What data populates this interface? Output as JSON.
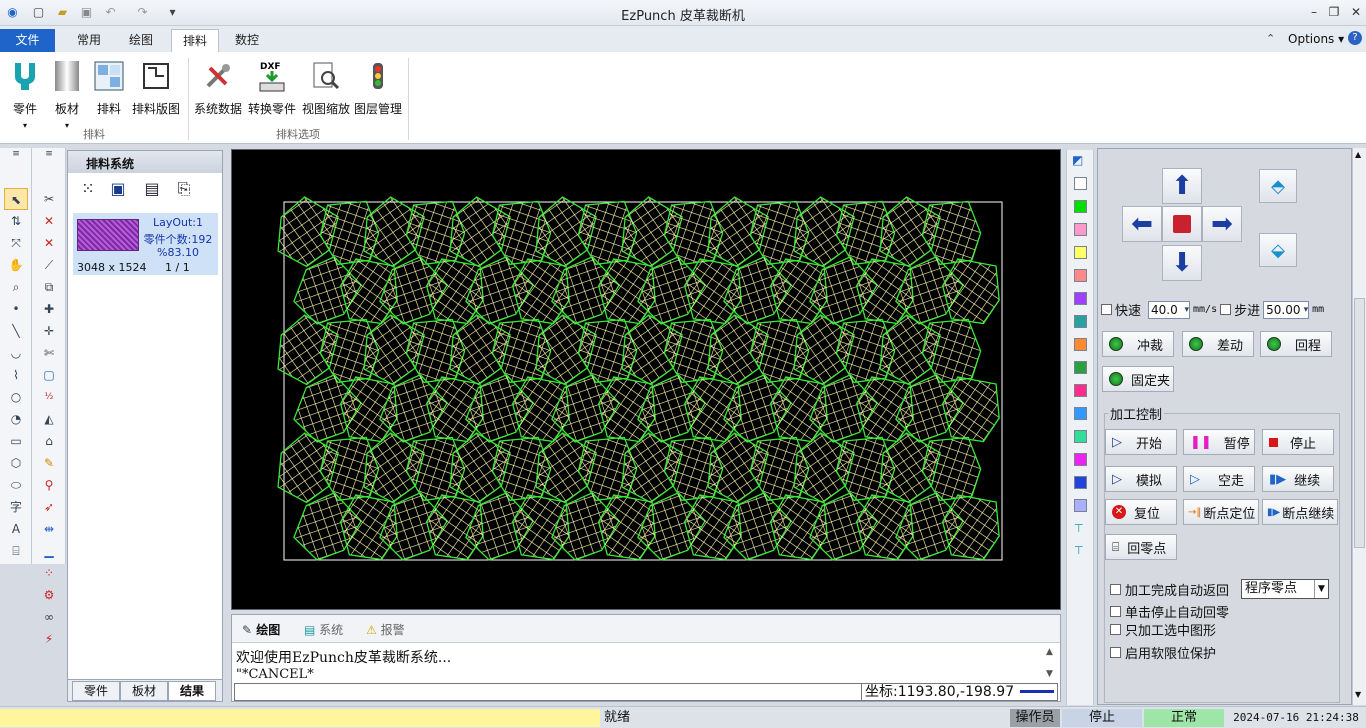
{
  "window": {
    "title": "EzPunch 皮革裁断机",
    "options_label": "Options"
  },
  "tabs": [
    {
      "label": "文件"
    },
    {
      "label": "常用"
    },
    {
      "label": "绘图"
    },
    {
      "label": "排料"
    },
    {
      "label": "数控"
    }
  ],
  "ribbon": {
    "group1": {
      "label": "排料",
      "buttons": [
        {
          "label": "零件",
          "icon": "part-icon"
        },
        {
          "label": "板材",
          "icon": "sheet-icon"
        },
        {
          "label": "排料",
          "icon": "nesting-icon"
        },
        {
          "label": "排料版图",
          "icon": "layout-icon"
        }
      ]
    },
    "group2": {
      "label": "排料选项",
      "buttons": [
        {
          "label": "系统数据",
          "icon": "settings-tools-icon"
        },
        {
          "label": "转换零件",
          "icon": "dxf-convert-icon"
        },
        {
          "label": "视图缩放",
          "icon": "zoom-view-icon"
        },
        {
          "label": "图层管理",
          "icon": "layer-traffic-icon"
        }
      ]
    }
  },
  "nest_panel": {
    "title": "排料系统",
    "layout": {
      "name": "LayOut:1",
      "count": "零件个数:192",
      "percent": "%83.10",
      "size": "3048 x 1524",
      "page": "1 / 1"
    },
    "tabs": [
      {
        "label": "零件"
      },
      {
        "label": "板材"
      },
      {
        "label": "结果"
      }
    ]
  },
  "command": {
    "tabs": [
      {
        "label": "绘图"
      },
      {
        "label": "系统"
      },
      {
        "label": "报警"
      }
    ],
    "line1": "欢迎使用EzPunch皮革裁断系统...",
    "line2": "\"*CANCEL*",
    "coord": "坐标:1193.80,-198.97"
  },
  "control": {
    "fast_label": "快速",
    "fast_value": "40.0",
    "speed_unit": "mm/s",
    "step_label": "步进",
    "step_value": "50.00",
    "step_unit": "mm",
    "punch": "冲裁",
    "jog": "差动",
    "return": "回程",
    "clamp": "固定夹",
    "group_title": "加工控制",
    "start": "开始",
    "pause": "暂停",
    "stop": "停止",
    "simulate": "模拟",
    "dry_run": "空走",
    "resume": "继续",
    "reset": "复位",
    "bp_locate": "断点定位",
    "bp_resume": "断点继续",
    "home": "回零点",
    "auto_return": "加工完成自动返回",
    "zero_select": "程序零点",
    "single_stop": "单击停止自动回零",
    "only_selected": "只加工选中图形",
    "soft_limit": "启用软限位保护"
  },
  "status": {
    "ready": "就绪",
    "user": "操作员",
    "state": "停止",
    "mode": "正常",
    "datetime": "2024-07-16 21:24:38"
  },
  "colors": {
    "canvas_bg": "#000000",
    "part_green": "#39e639",
    "hatch": "#fffcb0",
    "accent_blue": "#1f64c8"
  }
}
